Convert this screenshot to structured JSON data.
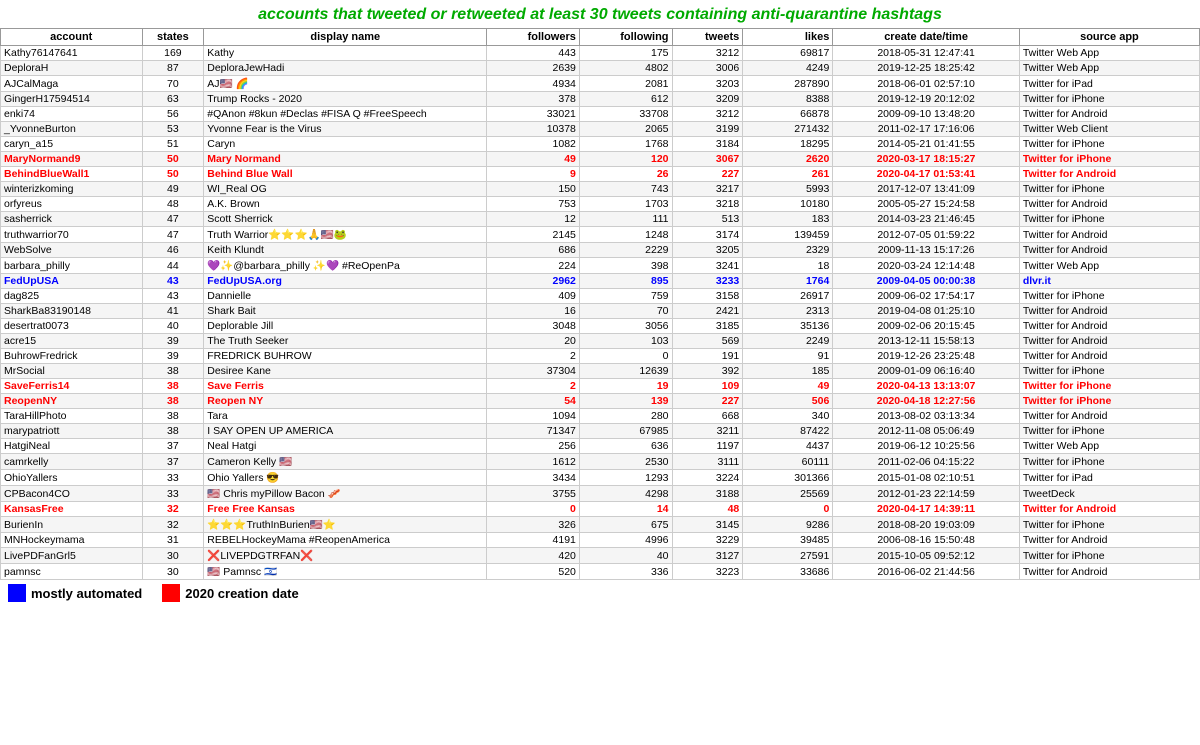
{
  "title": "accounts that tweeted or retweeted at least 30 tweets containing anti-quarantine hashtags",
  "columns": [
    "account",
    "states",
    "display name",
    "followers",
    "following",
    "tweets",
    "likes",
    "create date/time",
    "source app"
  ],
  "rows": [
    {
      "account": "Kathy76147641",
      "states": "169",
      "display": "Kathy",
      "followers": "443",
      "following": "175",
      "tweets": "3212",
      "likes": "69817",
      "created": "2018-05-31 12:47:41",
      "source": "Twitter Web App",
      "highlight": ""
    },
    {
      "account": "DeploraH",
      "states": "87",
      "display": "DeploraJewHadi",
      "followers": "2639",
      "following": "4802",
      "tweets": "3006",
      "likes": "4249",
      "created": "2019-12-25 18:25:42",
      "source": "Twitter Web App",
      "highlight": ""
    },
    {
      "account": "AJCalMaga",
      "states": "70",
      "display": "AJ🇺🇸 🌈",
      "followers": "4934",
      "following": "2081",
      "tweets": "3203",
      "likes": "287890",
      "created": "2018-06-01 02:57:10",
      "source": "Twitter for iPad",
      "highlight": ""
    },
    {
      "account": "GingerH17594514",
      "states": "63",
      "display": "Trump Rocks - 2020",
      "followers": "378",
      "following": "612",
      "tweets": "3209",
      "likes": "8388",
      "created": "2019-12-19 20:12:02",
      "source": "Twitter for iPhone",
      "highlight": ""
    },
    {
      "account": "enki74",
      "states": "56",
      "display": "#QAnon #8kun #Declas #FISA Q #FreeSpeech",
      "followers": "33021",
      "following": "33708",
      "tweets": "3212",
      "likes": "66878",
      "created": "2009-09-10 13:48:20",
      "source": "Twitter for Android",
      "highlight": ""
    },
    {
      "account": "_YvonneBurton",
      "states": "53",
      "display": "Yvonne Fear is the Virus",
      "followers": "10378",
      "following": "2065",
      "tweets": "3199",
      "likes": "271432",
      "created": "2011-02-17 17:16:06",
      "source": "Twitter Web Client",
      "highlight": ""
    },
    {
      "account": "caryn_a15",
      "states": "51",
      "display": "Caryn",
      "followers": "1082",
      "following": "1768",
      "tweets": "3184",
      "likes": "18295",
      "created": "2014-05-21 01:41:55",
      "source": "Twitter for iPhone",
      "highlight": ""
    },
    {
      "account": "MaryNormand9",
      "states": "50",
      "display": "Mary Normand",
      "followers": "49",
      "following": "120",
      "tweets": "3067",
      "likes": "2620",
      "created": "2020-03-17 18:15:27",
      "source": "Twitter for iPhone",
      "highlight": "red"
    },
    {
      "account": "BehindBlueWall1",
      "states": "50",
      "display": "Behind Blue Wall",
      "followers": "9",
      "following": "26",
      "tweets": "227",
      "likes": "261",
      "created": "2020-04-17 01:53:41",
      "source": "Twitter for Android",
      "highlight": "red"
    },
    {
      "account": "winterizkoming",
      "states": "49",
      "display": "WI_Real OG",
      "followers": "150",
      "following": "743",
      "tweets": "3217",
      "likes": "5993",
      "created": "2017-12-07 13:41:09",
      "source": "Twitter for iPhone",
      "highlight": ""
    },
    {
      "account": "orfyreus",
      "states": "48",
      "display": "A.K. Brown",
      "followers": "753",
      "following": "1703",
      "tweets": "3218",
      "likes": "10180",
      "created": "2005-05-27 15:24:58",
      "source": "Twitter for Android",
      "highlight": ""
    },
    {
      "account": "sasherrick",
      "states": "47",
      "display": "Scott Sherrick",
      "followers": "12",
      "following": "111",
      "tweets": "513",
      "likes": "183",
      "created": "2014-03-23 21:46:45",
      "source": "Twitter for iPhone",
      "highlight": ""
    },
    {
      "account": "truthwarrior70",
      "states": "47",
      "display": "Truth Warrior⭐⭐⭐🙏🇺🇸🐸",
      "followers": "2145",
      "following": "1248",
      "tweets": "3174",
      "likes": "139459",
      "created": "2012-07-05 01:59:22",
      "source": "Twitter for Android",
      "highlight": ""
    },
    {
      "account": "WebSolve",
      "states": "46",
      "display": "Keith Klundt",
      "followers": "686",
      "following": "2229",
      "tweets": "3205",
      "likes": "2329",
      "created": "2009-11-13 15:17:26",
      "source": "Twitter for Android",
      "highlight": ""
    },
    {
      "account": "barbara_philly",
      "states": "44",
      "display": "💜✨@barbara_philly ✨💜 #ReOpenPa",
      "followers": "224",
      "following": "398",
      "tweets": "3241",
      "likes": "18",
      "created": "2020-03-24 12:14:48",
      "source": "Twitter Web App",
      "highlight": ""
    },
    {
      "account": "FedUpUSA",
      "states": "43",
      "display": "FedUpUSA.org",
      "followers": "2962",
      "following": "895",
      "tweets": "3233",
      "likes": "1764",
      "created": "2009-04-05 00:00:38",
      "source": "dlvr.it",
      "highlight": "blue"
    },
    {
      "account": "dag825",
      "states": "43",
      "display": "Dannielle",
      "followers": "409",
      "following": "759",
      "tweets": "3158",
      "likes": "26917",
      "created": "2009-06-02 17:54:17",
      "source": "Twitter for iPhone",
      "highlight": ""
    },
    {
      "account": "SharkBa83190148",
      "states": "41",
      "display": "Shark Bait",
      "followers": "16",
      "following": "70",
      "tweets": "2421",
      "likes": "2313",
      "created": "2019-04-08 01:25:10",
      "source": "Twitter for Android",
      "highlight": ""
    },
    {
      "account": "desertrat0073",
      "states": "40",
      "display": "Deplorable Jill",
      "followers": "3048",
      "following": "3056",
      "tweets": "3185",
      "likes": "35136",
      "created": "2009-02-06 20:15:45",
      "source": "Twitter for Android",
      "highlight": ""
    },
    {
      "account": "acre15",
      "states": "39",
      "display": "The Truth Seeker",
      "followers": "20",
      "following": "103",
      "tweets": "569",
      "likes": "2249",
      "created": "2013-12-11 15:58:13",
      "source": "Twitter for Android",
      "highlight": ""
    },
    {
      "account": "BuhrowFredrick",
      "states": "39",
      "display": "FREDRICK BUHROW",
      "followers": "2",
      "following": "0",
      "tweets": "191",
      "likes": "91",
      "created": "2019-12-26 23:25:48",
      "source": "Twitter for Android",
      "highlight": ""
    },
    {
      "account": "MrSocial",
      "states": "38",
      "display": "Desiree Kane",
      "followers": "37304",
      "following": "12639",
      "tweets": "392",
      "likes": "185",
      "created": "2009-01-09 06:16:40",
      "source": "Twitter for iPhone",
      "highlight": ""
    },
    {
      "account": "SaveFerris14",
      "states": "38",
      "display": "Save Ferris",
      "followers": "2",
      "following": "19",
      "tweets": "109",
      "likes": "49",
      "created": "2020-04-13 13:13:07",
      "source": "Twitter for iPhone",
      "highlight": "red"
    },
    {
      "account": "ReopenNY",
      "states": "38",
      "display": "Reopen NY",
      "followers": "54",
      "following": "139",
      "tweets": "227",
      "likes": "506",
      "created": "2020-04-18 12:27:56",
      "source": "Twitter for iPhone",
      "highlight": "red"
    },
    {
      "account": "TaraHillPhoto",
      "states": "38",
      "display": "Tara",
      "followers": "1094",
      "following": "280",
      "tweets": "668",
      "likes": "340",
      "created": "2013-08-02 03:13:34",
      "source": "Twitter for Android",
      "highlight": ""
    },
    {
      "account": "marypatriott",
      "states": "38",
      "display": "I SAY OPEN UP AMERICA",
      "followers": "71347",
      "following": "67985",
      "tweets": "3211",
      "likes": "87422",
      "created": "2012-11-08 05:06:49",
      "source": "Twitter for iPhone",
      "highlight": ""
    },
    {
      "account": "HatgiNeal",
      "states": "37",
      "display": "Neal Hatgi",
      "followers": "256",
      "following": "636",
      "tweets": "1197",
      "likes": "4437",
      "created": "2019-06-12 10:25:56",
      "source": "Twitter Web App",
      "highlight": ""
    },
    {
      "account": "camrkelly",
      "states": "37",
      "display": "Cameron Kelly 🇺🇸",
      "followers": "1612",
      "following": "2530",
      "tweets": "3111",
      "likes": "60111",
      "created": "2011-02-06 04:15:22",
      "source": "Twitter for iPhone",
      "highlight": ""
    },
    {
      "account": "OhioYallers",
      "states": "33",
      "display": "Ohio Yallers 😎",
      "followers": "3434",
      "following": "1293",
      "tweets": "3224",
      "likes": "301366",
      "created": "2015-01-08 02:10:51",
      "source": "Twitter for iPad",
      "highlight": ""
    },
    {
      "account": "CPBacon4CO",
      "states": "33",
      "display": "🇺🇸 Chris myPillow Bacon 🥓",
      "followers": "3755",
      "following": "4298",
      "tweets": "3188",
      "likes": "25569",
      "created": "2012-01-23 22:14:59",
      "source": "TweetDeck",
      "highlight": ""
    },
    {
      "account": "KansasFree",
      "states": "32",
      "display": "Free Free Kansas",
      "followers": "0",
      "following": "14",
      "tweets": "48",
      "likes": "0",
      "created": "2020-04-17 14:39:11",
      "source": "Twitter for Android",
      "highlight": "red"
    },
    {
      "account": "BurienIn",
      "states": "32",
      "display": "⭐⭐⭐TruthInBurien🇺🇸⭐",
      "followers": "326",
      "following": "675",
      "tweets": "3145",
      "likes": "9286",
      "created": "2018-08-20 19:03:09",
      "source": "Twitter for iPhone",
      "highlight": ""
    },
    {
      "account": "MNHockeymama",
      "states": "31",
      "display": "REBELHockeyMama #ReopenAmerica",
      "followers": "4191",
      "following": "4996",
      "tweets": "3229",
      "likes": "39485",
      "created": "2006-08-16 15:50:48",
      "source": "Twitter for Android",
      "highlight": ""
    },
    {
      "account": "LivePDFanGrl5",
      "states": "30",
      "display": "❌LIVEPDGTRFAN❌",
      "followers": "420",
      "following": "40",
      "tweets": "3127",
      "likes": "27591",
      "created": "2015-10-05 09:52:12",
      "source": "Twitter for iPhone",
      "highlight": ""
    },
    {
      "account": "pamnsc",
      "states": "30",
      "display": "🇺🇸 Pamnsc 🇮🇱",
      "followers": "520",
      "following": "336",
      "tweets": "3223",
      "likes": "33686",
      "created": "2016-06-02 21:44:56",
      "source": "Twitter for Android",
      "highlight": ""
    }
  ],
  "legend": {
    "blue_label": "mostly automated",
    "red_label": "2020 creation date"
  }
}
